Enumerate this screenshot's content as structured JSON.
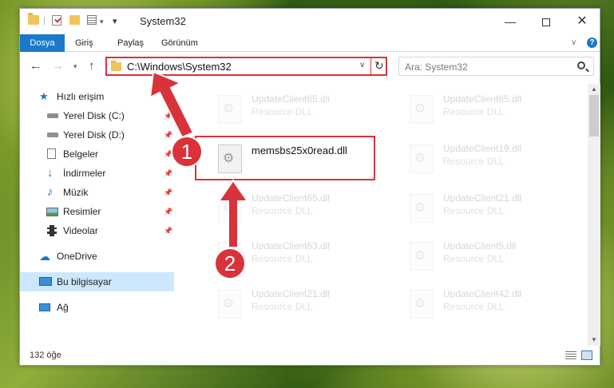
{
  "window": {
    "title": "System32",
    "controls": {
      "minimize": "—",
      "maximize": "",
      "close": "✕"
    }
  },
  "ribbon": {
    "tabs": [
      "Dosya",
      "Giriş",
      "Paylaş",
      "Görünüm"
    ]
  },
  "navigation": {
    "address": "C:\\Windows\\System32",
    "search_placeholder": "Ara: System32"
  },
  "sidebar": {
    "items": [
      {
        "label": "Hızlı erişim",
        "icon": "star-icon",
        "pinned": false
      },
      {
        "label": "Yerel Disk (C:)",
        "icon": "drive-icon",
        "pinned": true
      },
      {
        "label": "Yerel Disk (D:)",
        "icon": "drive-icon",
        "pinned": true
      },
      {
        "label": "Belgeler",
        "icon": "documents-icon",
        "pinned": true
      },
      {
        "label": "İndirmeler",
        "icon": "download-icon",
        "pinned": true
      },
      {
        "label": "Müzik",
        "icon": "music-icon",
        "pinned": true
      },
      {
        "label": "Resimler",
        "icon": "pictures-icon",
        "pinned": true
      },
      {
        "label": "Videolar",
        "icon": "video-icon",
        "pinned": true
      },
      {
        "label": "OneDrive",
        "icon": "cloud-icon"
      },
      {
        "label": "Bu bilgisayar",
        "icon": "computer-icon",
        "selected": true
      },
      {
        "label": "Ağ",
        "icon": "network-icon"
      }
    ]
  },
  "files": [
    {
      "name": "UpdateClient65.dll",
      "type": "Resource DLL"
    },
    {
      "name": "UpdateClient65.dll",
      "type": "Resource DLL"
    },
    {
      "name": "memsbs25x0read.dll",
      "type": ""
    },
    {
      "name": "UpdateClient19.dll",
      "type": "Resource DLL"
    },
    {
      "name": "UpdateClient65.dll",
      "type": "Resource DLL"
    },
    {
      "name": "UpdateClient21.dll",
      "type": "Resource DLL"
    },
    {
      "name": "UpdateClient63.dll",
      "type": "Resource DLL"
    },
    {
      "name": "UpdateClient5.dll",
      "type": "Resource DLL"
    },
    {
      "name": "UpdateClient21.dll",
      "type": "Resource DLL"
    },
    {
      "name": "UpdateClient42.dll",
      "type": "Resource DLL"
    }
  ],
  "status": {
    "item_count": "132 öğe"
  },
  "annotations": {
    "step1": "1",
    "step2": "2"
  },
  "colors": {
    "accent": "#1979ca",
    "highlight": "#d8333b",
    "selected": "#cce8ff"
  }
}
